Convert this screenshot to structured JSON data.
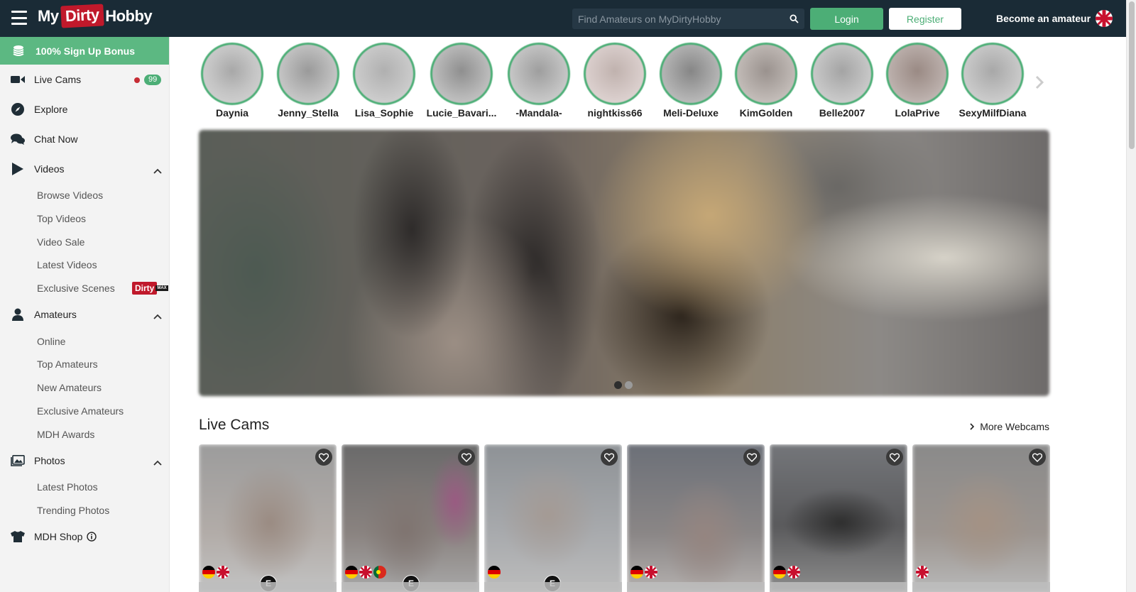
{
  "header": {
    "logo": {
      "part1": "My",
      "part2": "Dirty",
      "part3": "Hobby"
    },
    "search_placeholder": "Find Amateurs on MyDirtyHobby",
    "login_label": "Login",
    "register_label": "Register",
    "become_label": "Become an amateur",
    "language_icon": "uk-flag-icon"
  },
  "sidebar": {
    "bonus_label": "100% Sign Up Bonus",
    "live_cams": {
      "label": "Live Cams",
      "count": "99"
    },
    "explore": "Explore",
    "chat_now": "Chat Now",
    "videos": {
      "label": "Videos",
      "items": [
        "Browse Videos",
        "Top Videos",
        "Video Sale",
        "Latest Videos",
        "Exclusive Scenes"
      ],
      "badge": {
        "brand": "Dirty",
        "suffix": "MAX"
      }
    },
    "amateurs": {
      "label": "Amateurs",
      "items": [
        "Online",
        "Top Amateurs",
        "New Amateurs",
        "Exclusive Amateurs",
        "MDH Awards"
      ]
    },
    "photos": {
      "label": "Photos",
      "items": [
        "Latest Photos",
        "Trending Photos"
      ]
    },
    "shop": "MDH Shop"
  },
  "stories": [
    "Daynia",
    "Jenny_Stella",
    "Lisa_Sophie",
    "Lucie_Bavari...",
    "-Mandala-",
    "nightkiss66",
    "Meli-Deluxe",
    "KimGolden",
    "Belle2007",
    "LolaPrive",
    "SexyMilfDiana"
  ],
  "banner": {
    "slides": 2,
    "active_slide": 1
  },
  "live_cams": {
    "title": "Live Cams",
    "more_label": "More Webcams",
    "cards": [
      {
        "flags": [
          "de",
          "uk"
        ],
        "badge": "E"
      },
      {
        "flags": [
          "de",
          "uk",
          "pt"
        ],
        "badge": "E"
      },
      {
        "flags": [
          "de"
        ],
        "badge": "E"
      },
      {
        "flags": [
          "de",
          "uk"
        ],
        "badge": ""
      },
      {
        "flags": [
          "de",
          "uk"
        ],
        "badge": ""
      },
      {
        "flags": [
          "uk"
        ],
        "badge": ""
      }
    ]
  },
  "colors": {
    "topbar": "#1a2b36",
    "accent_green": "#4cae76",
    "brand_red": "#c0192b",
    "live_dot": "#c62c34"
  }
}
